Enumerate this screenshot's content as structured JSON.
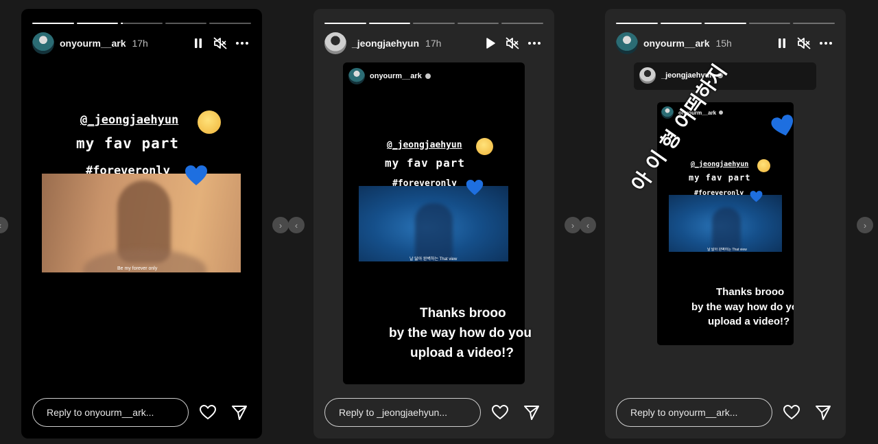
{
  "nav_arrows": {
    "left": "‹",
    "right": "›"
  },
  "stories": [
    {
      "username": "onyourm__ark",
      "time": "17h",
      "reply_placeholder": "Reply to onyourm__ark...",
      "progress": [
        1,
        1,
        0.05,
        0,
        0
      ],
      "text": {
        "mention": "@_jeongjaehyun",
        "line2": "my fav part",
        "hashtag": "#foreveronly"
      },
      "video_caption": "Be my forever only",
      "play_state": "pause",
      "muted": true
    },
    {
      "username": "_jeongjaehyun",
      "time": "17h",
      "reply_placeholder": "Reply to _jeongjaehyun...",
      "progress": [
        1,
        1,
        0,
        0,
        0
      ],
      "shared_post": {
        "username": "onyourm__ark",
        "text": {
          "mention": "@_jeongjaehyun",
          "line2": "my fav part",
          "hashtag": "#foreveronly"
        },
        "video_caption": "날 닮아 완벽하는 That view"
      },
      "message": [
        "Thanks brooo",
        "by the way how do you",
        "upload a video!?"
      ],
      "play_state": "play",
      "muted": true
    },
    {
      "username": "onyourm__ark",
      "time": "15h",
      "reply_placeholder": "Reply to onyourm__ark...",
      "progress": [
        1,
        1,
        1,
        0,
        0
      ],
      "shared_post": {
        "username": "_jeongjaehyun",
        "inner_username": "onyourm__ark",
        "text": {
          "mention": "@_jeongjaehyun",
          "line2": "my fav part",
          "hashtag": "#foreveronly"
        },
        "video_caption": "날 닮아 완벽하는 That view"
      },
      "message": [
        "Thanks brooo",
        "by the way how do you",
        "upload a video!?"
      ],
      "korean_text": "아 이 형 어떡하지",
      "play_state": "pause",
      "muted": true
    }
  ],
  "colors": {
    "heart_blue": "#1e6fe0",
    "emoji_yellow": "#f5c84a"
  }
}
